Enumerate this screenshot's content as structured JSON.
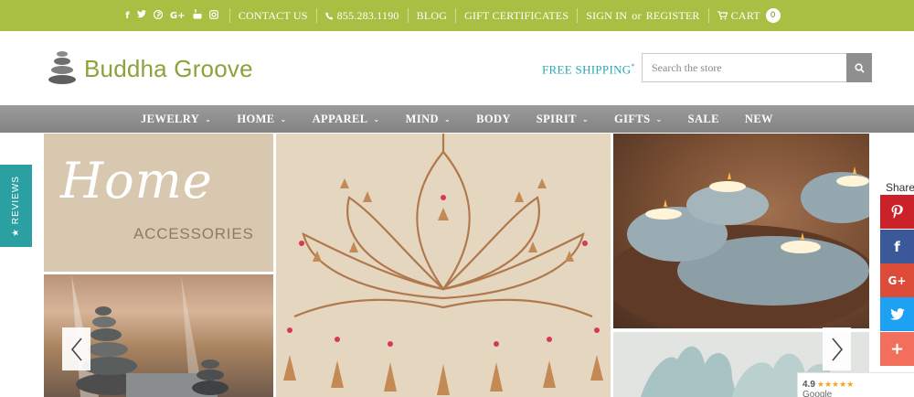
{
  "topbar": {
    "social_icons": [
      "facebook-icon",
      "twitter-icon",
      "pinterest-icon",
      "google-plus-icon",
      "youtube-icon",
      "instagram-icon"
    ],
    "contact_us": "CONTACT US",
    "phone": "855.283.1190",
    "blog": "BLOG",
    "gift_certificates": "GIFT CERTIFICATES",
    "sign_in": "SIGN IN",
    "or": "or",
    "register": "REGISTER",
    "cart": "CART",
    "cart_count": "0"
  },
  "header": {
    "brand": "Buddha Groove",
    "free_shipping": "FREE SHIPPING",
    "free_shipping_mark": "*",
    "search_placeholder": "Search the store"
  },
  "nav": {
    "items": [
      {
        "label": "JEWELRY",
        "dropdown": true
      },
      {
        "label": "HOME",
        "dropdown": true
      },
      {
        "label": "APPAREL",
        "dropdown": true
      },
      {
        "label": "MIND",
        "dropdown": true
      },
      {
        "label": "BODY",
        "dropdown": false
      },
      {
        "label": "SPIRIT",
        "dropdown": true
      },
      {
        "label": "GIFTS",
        "dropdown": true
      },
      {
        "label": "SALE",
        "dropdown": false
      },
      {
        "label": "NEW",
        "dropdown": false
      }
    ]
  },
  "hero": {
    "home_title": "Home",
    "home_subtitle": "ACCESSORIES"
  },
  "reviews_tab": {
    "label": "★ REVIEWS"
  },
  "share": {
    "label": "Share",
    "buttons": [
      "pinterest-icon",
      "facebook-icon",
      "google-plus-icon",
      "twitter-icon",
      "plus-icon"
    ]
  },
  "rating": {
    "score": "4.9",
    "stars": "★★★★★",
    "source": "Google"
  },
  "colors": {
    "topbar": "#a9bf44",
    "nav": "#8f8f8f",
    "brand": "#8aa33a",
    "free_shipping": "#2ba6b5",
    "reviews_tab": "#2aa0a2"
  }
}
